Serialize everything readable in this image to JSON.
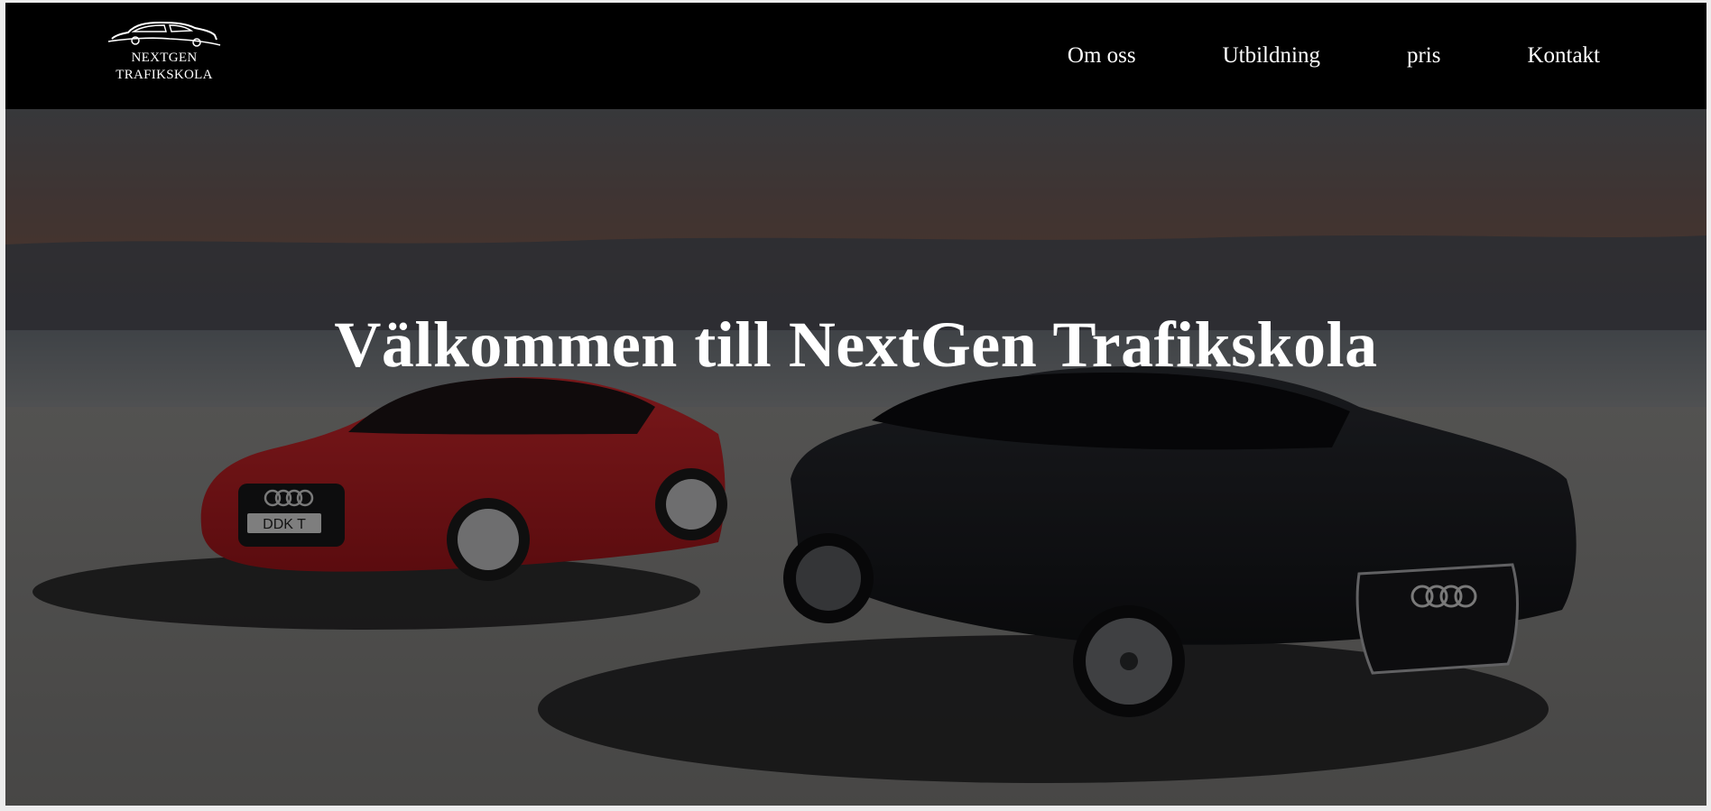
{
  "brand": {
    "line1": "NEXTGEN",
    "line2": "TRAFIKSKOLA"
  },
  "nav": {
    "items": [
      "Om oss",
      "Utbildning",
      "pris",
      "Kontakt"
    ]
  },
  "hero": {
    "title": "Välkommen till NextGen Trafikskola",
    "red_car_plate": "DDK T"
  },
  "colors": {
    "header_bg": "#000000",
    "text": "#ffffff",
    "red_car": "#8e1a1e",
    "black_car": "#15161a",
    "overlay": "rgba(0,0,0,0.5)"
  },
  "icons": {
    "logo": "car-silhouette-icon"
  }
}
